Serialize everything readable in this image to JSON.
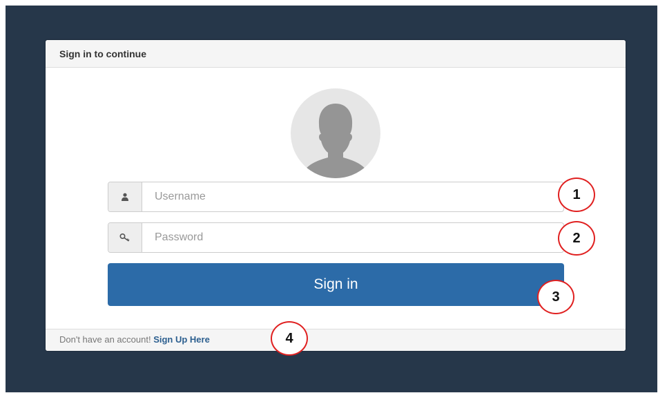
{
  "panel": {
    "heading": "Sign in to continue"
  },
  "form": {
    "username_placeholder": "Username",
    "password_placeholder": "Password",
    "signin_label": "Sign in",
    "accent_color": "#2c6ba8"
  },
  "footer": {
    "text": "Don't have an account!",
    "link_label": "Sign Up Here"
  },
  "icons": {
    "avatar": "user-silhouette-icon",
    "username": "user-icon",
    "password": "key-icon"
  },
  "annotations": [
    "1",
    "2",
    "3",
    "4"
  ]
}
